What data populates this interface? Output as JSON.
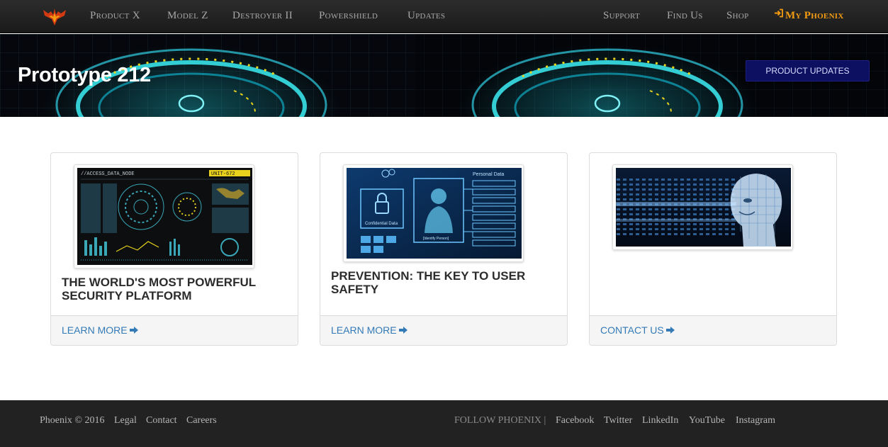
{
  "colors": {
    "navbar_bg": "#222222",
    "accent": "#f39c12",
    "link": "#337ab7",
    "hero_button": "#0d1060",
    "footer_bg": "#222222"
  },
  "nav": {
    "logo_icon": "phoenix-logo-icon",
    "left_items": [
      "Product X",
      "Model Z",
      "Destroyer II",
      "Powershield",
      "Updates"
    ],
    "right_items": [
      "Support",
      "Find Us",
      "Shop"
    ],
    "account_label": "My Phoenix",
    "account_icon": "sign-in-icon"
  },
  "hero": {
    "title": "Prototype 212",
    "button_label": "PRODUCT UPDATES"
  },
  "cards": [
    {
      "image_icon": "hud-dashboard-image",
      "image_text": [
        "//ACCESS_DATA_NODE",
        "UNIT-672"
      ],
      "title": "The World's Most Powerful Security Platform",
      "link_label": "LEARN MORE",
      "link_icon": "arrow-right-icon"
    },
    {
      "image_icon": "data-security-image",
      "image_text": [
        "Personal Data",
        "Confidential Data",
        "[Identify Person]"
      ],
      "title": "Prevention: The Key to User Safety",
      "link_label": "LEARN MORE",
      "link_icon": "arrow-right-icon"
    },
    {
      "image_icon": "digital-face-image",
      "title": "",
      "link_label": "CONTACT US",
      "link_icon": "arrow-right-icon"
    }
  ],
  "footer": {
    "copyright": "Phoenix © 2016",
    "links": [
      "Legal",
      "Contact",
      "Careers"
    ],
    "follow_label": "FOLLOW PHOENIX |",
    "social": [
      "Facebook",
      "Twitter",
      "LinkedIn",
      "YouTube",
      "Instagram"
    ]
  }
}
